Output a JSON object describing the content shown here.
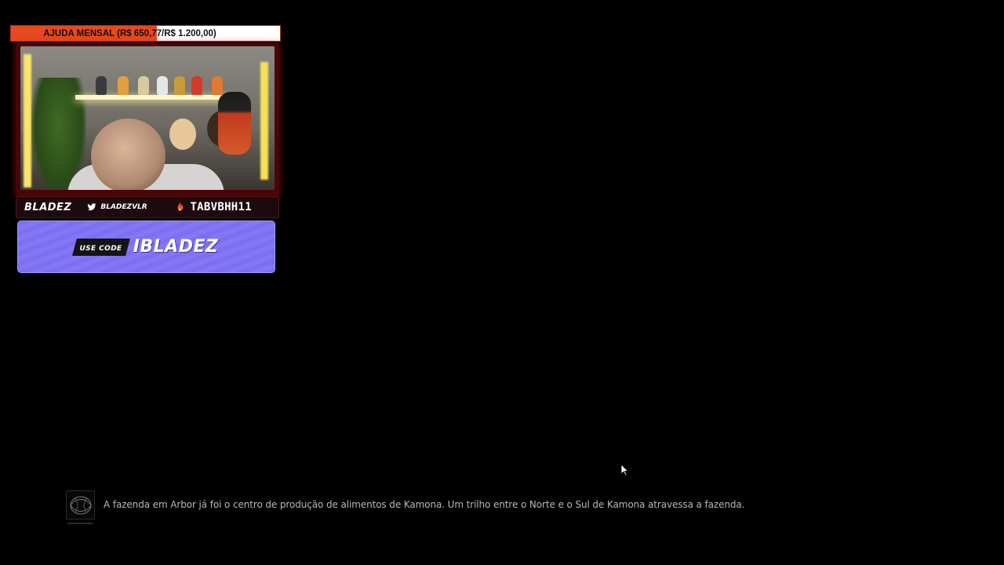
{
  "goal": {
    "text": "AJUDA MENSAL (R$ 650,77/R$ 1.200,00)",
    "current": 650.77,
    "target": 1200.0,
    "fill_color": "#e8491f"
  },
  "webcam": {
    "accent_color": "#c81a1a"
  },
  "social": {
    "brand": "BLADEZ",
    "twitter_icon": "twitter-icon",
    "twitter_handle": "BLADEZVLR",
    "fire_icon": "fire-icon",
    "fire_label": "TABVBHH11"
  },
  "code_banner": {
    "prefix": "USE CODE",
    "code": "IBLADEZ",
    "color": "#7d6ff2"
  },
  "lore": {
    "icon": "codex-icon",
    "text": "A fazenda em Arbor já foi o centro de produção de alimentos de Kamona. Um trilho entre o Norte e o Sul de Kamona atravessa a fazenda."
  }
}
